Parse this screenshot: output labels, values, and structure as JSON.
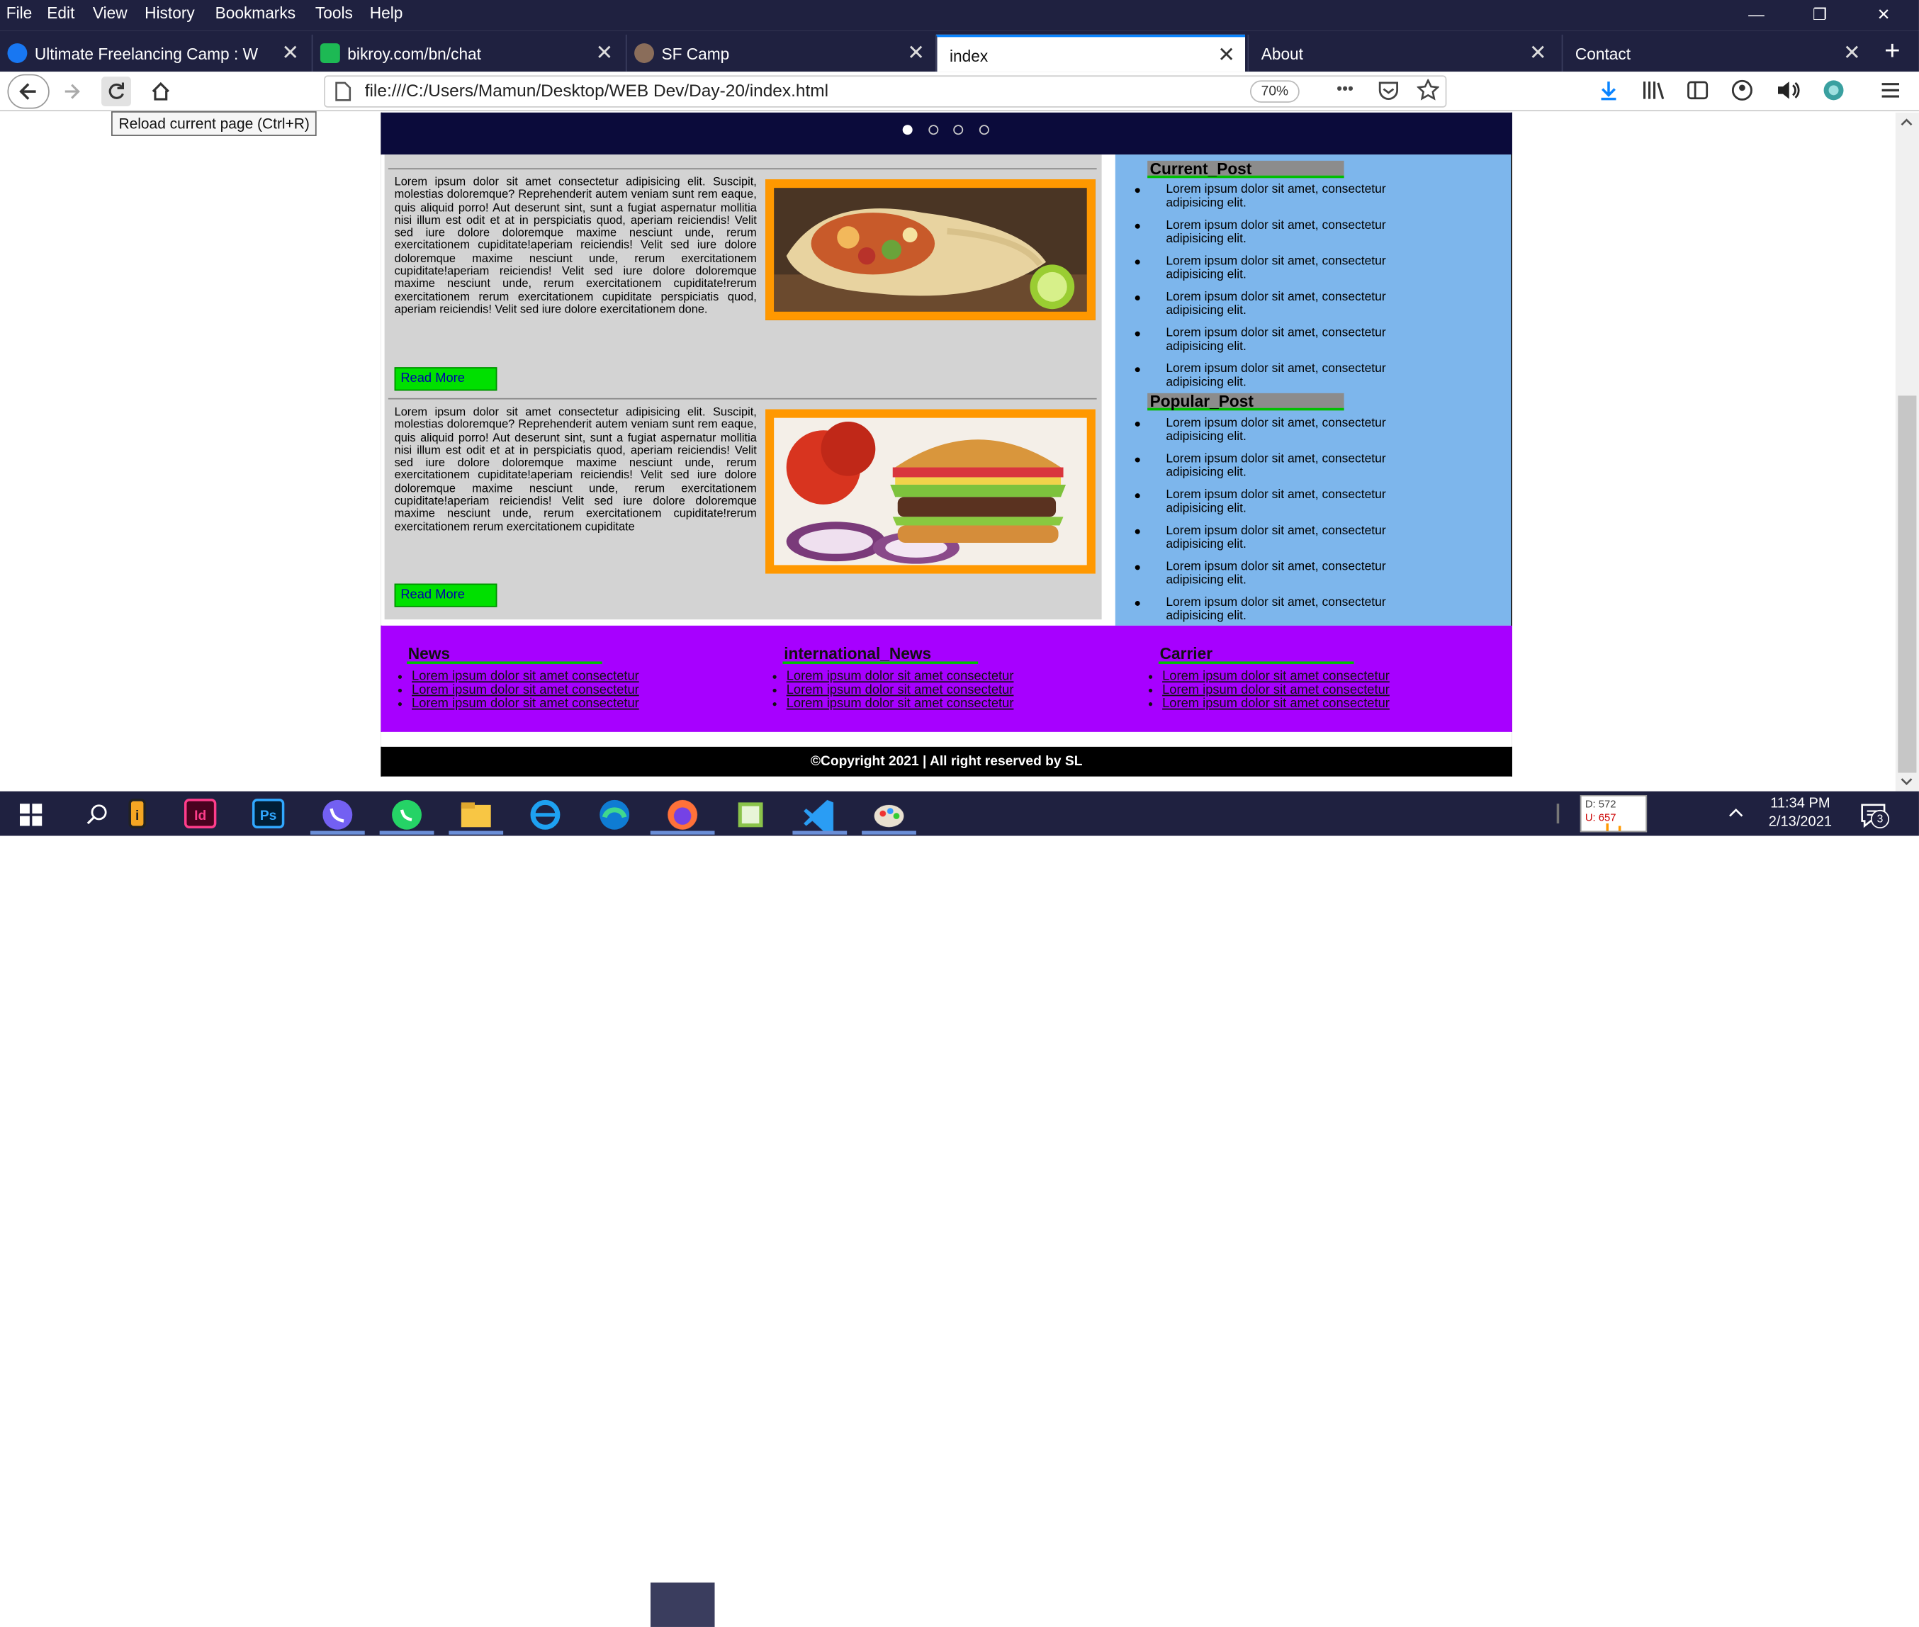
{
  "menu": [
    "File",
    "Edit",
    "View",
    "History",
    "Bookmarks",
    "Tools",
    "Help"
  ],
  "window_controls": {
    "minimize": "—",
    "restore": "❐",
    "close": "✕"
  },
  "tabs": [
    {
      "label": "Ultimate Freelancing Camp : W",
      "close": "✕"
    },
    {
      "label": "bikroy.com/bn/chat",
      "close": "✕"
    },
    {
      "label": "SF Camp",
      "close": "✕"
    },
    {
      "label": "index",
      "close": "✕"
    },
    {
      "label": "About",
      "close": "✕"
    },
    {
      "label": "Contact",
      "close": "✕"
    }
  ],
  "new_tab": "+",
  "nav": {
    "url": "file:///C:/Users/Mamun/Desktop/WEB Dev/Day-20/index.html",
    "zoom": "70%",
    "more": "•••",
    "tooltip": "Reload current page (Ctrl+R)"
  },
  "articles": [
    {
      "text": "Lorem ipsum dolor sit amet consectetur adipisicing elit. Suscipit, molestias doloremque? Reprehenderit autem veniam sunt rem eaque, quis aliquid porro! Aut deserunt sint, sunt a fugiat aspernatur mollitia nisi illum est odit et at in perspiciatis quod, aperiam reiciendis! Velit sed iure dolore doloremque maxime nesciunt unde, rerum exercitationem cupiditate!aperiam reiciendis! Velit sed iure dolore doloremque maxime nesciunt unde, rerum exercitationem cupiditate!aperiam reiciendis! Velit sed iure dolore doloremque maxime nesciunt unde, rerum exercitationem cupiditate!rerum exercitationem rerum exercitationem cupiditate perspiciatis quod, aperiam reiciendis! Velit sed iure dolore exercitationem done.",
      "button": "Read More"
    },
    {
      "text": "Lorem ipsum dolor sit amet consectetur adipisicing elit. Suscipit, molestias doloremque? Reprehenderit autem veniam sunt rem eaque, quis aliquid porro! Aut deserunt sint, sunt a fugiat aspernatur mollitia nisi illum est odit et at in perspiciatis quod, aperiam reiciendis! Velit sed iure dolore doloremque maxime nesciunt unde, rerum exercitationem cupiditate!aperiam reiciendis! Velit sed iure dolore doloremque maxime nesciunt unde, rerum exercitationem cupiditate!aperiam reiciendis! Velit sed iure dolore doloremque maxime nesciunt unde, rerum exercitationem cupiditate!rerum exercitationem rerum exercitationem cupiditate",
      "button": "Read More"
    }
  ],
  "sidebar": {
    "current_title": "Current_Post",
    "current_items": [
      "Lorem ipsum dolor sit amet, consectetur adipisicing elit.",
      "Lorem ipsum dolor sit amet, consectetur adipisicing elit.",
      "Lorem ipsum dolor sit amet, consectetur adipisicing elit.",
      "Lorem ipsum dolor sit amet, consectetur adipisicing elit.",
      "Lorem ipsum dolor sit amet, consectetur adipisicing elit.",
      "Lorem ipsum dolor sit amet, consectetur adipisicing elit."
    ],
    "popular_title": "Popular_Post",
    "popular_items": [
      "Lorem ipsum dolor sit amet, consectetur adipisicing elit.",
      "Lorem ipsum dolor sit amet, consectetur adipisicing elit.",
      "Lorem ipsum dolor sit amet, consectetur adipisicing elit.",
      "Lorem ipsum dolor sit amet, consectetur adipisicing elit.",
      "Lorem ipsum dolor sit amet, consectetur adipisicing elit.",
      "Lorem ipsum dolor sit amet, consectetur adipisicing elit."
    ]
  },
  "footer": {
    "columns": [
      {
        "title": "News",
        "links": [
          "Lorem ipsum dolor sit amet consectetur",
          "Lorem ipsum dolor sit amet consectetur",
          "Lorem ipsum dolor sit amet consectetur"
        ]
      },
      {
        "title": "international_News",
        "links": [
          "Lorem ipsum dolor sit amet consectetur",
          "Lorem ipsum dolor sit amet consectetur",
          "Lorem ipsum dolor sit amet consectetur"
        ]
      },
      {
        "title": "Carrier",
        "links": [
          "Lorem ipsum dolor sit amet consectetur",
          "Lorem ipsum dolor sit amet consectetur",
          "Lorem ipsum dolor sit amet consectetur"
        ]
      }
    ],
    "copyright": "©Copyright 2021 | All right reserved by SL"
  },
  "taskbar": {
    "ps_label": "Ps",
    "id_label": "Id",
    "i_label": "i",
    "meter": {
      "line1": "D: 572",
      "line2": "U: 657"
    },
    "time": "11:34 PM",
    "date": "2/13/2021",
    "notifications": "3"
  },
  "colors": {
    "accent": "#0a84ff",
    "footer": "#a700ff",
    "sidebar": "#7db6ec",
    "button": "#00e000",
    "img_border": "#ff9800"
  }
}
